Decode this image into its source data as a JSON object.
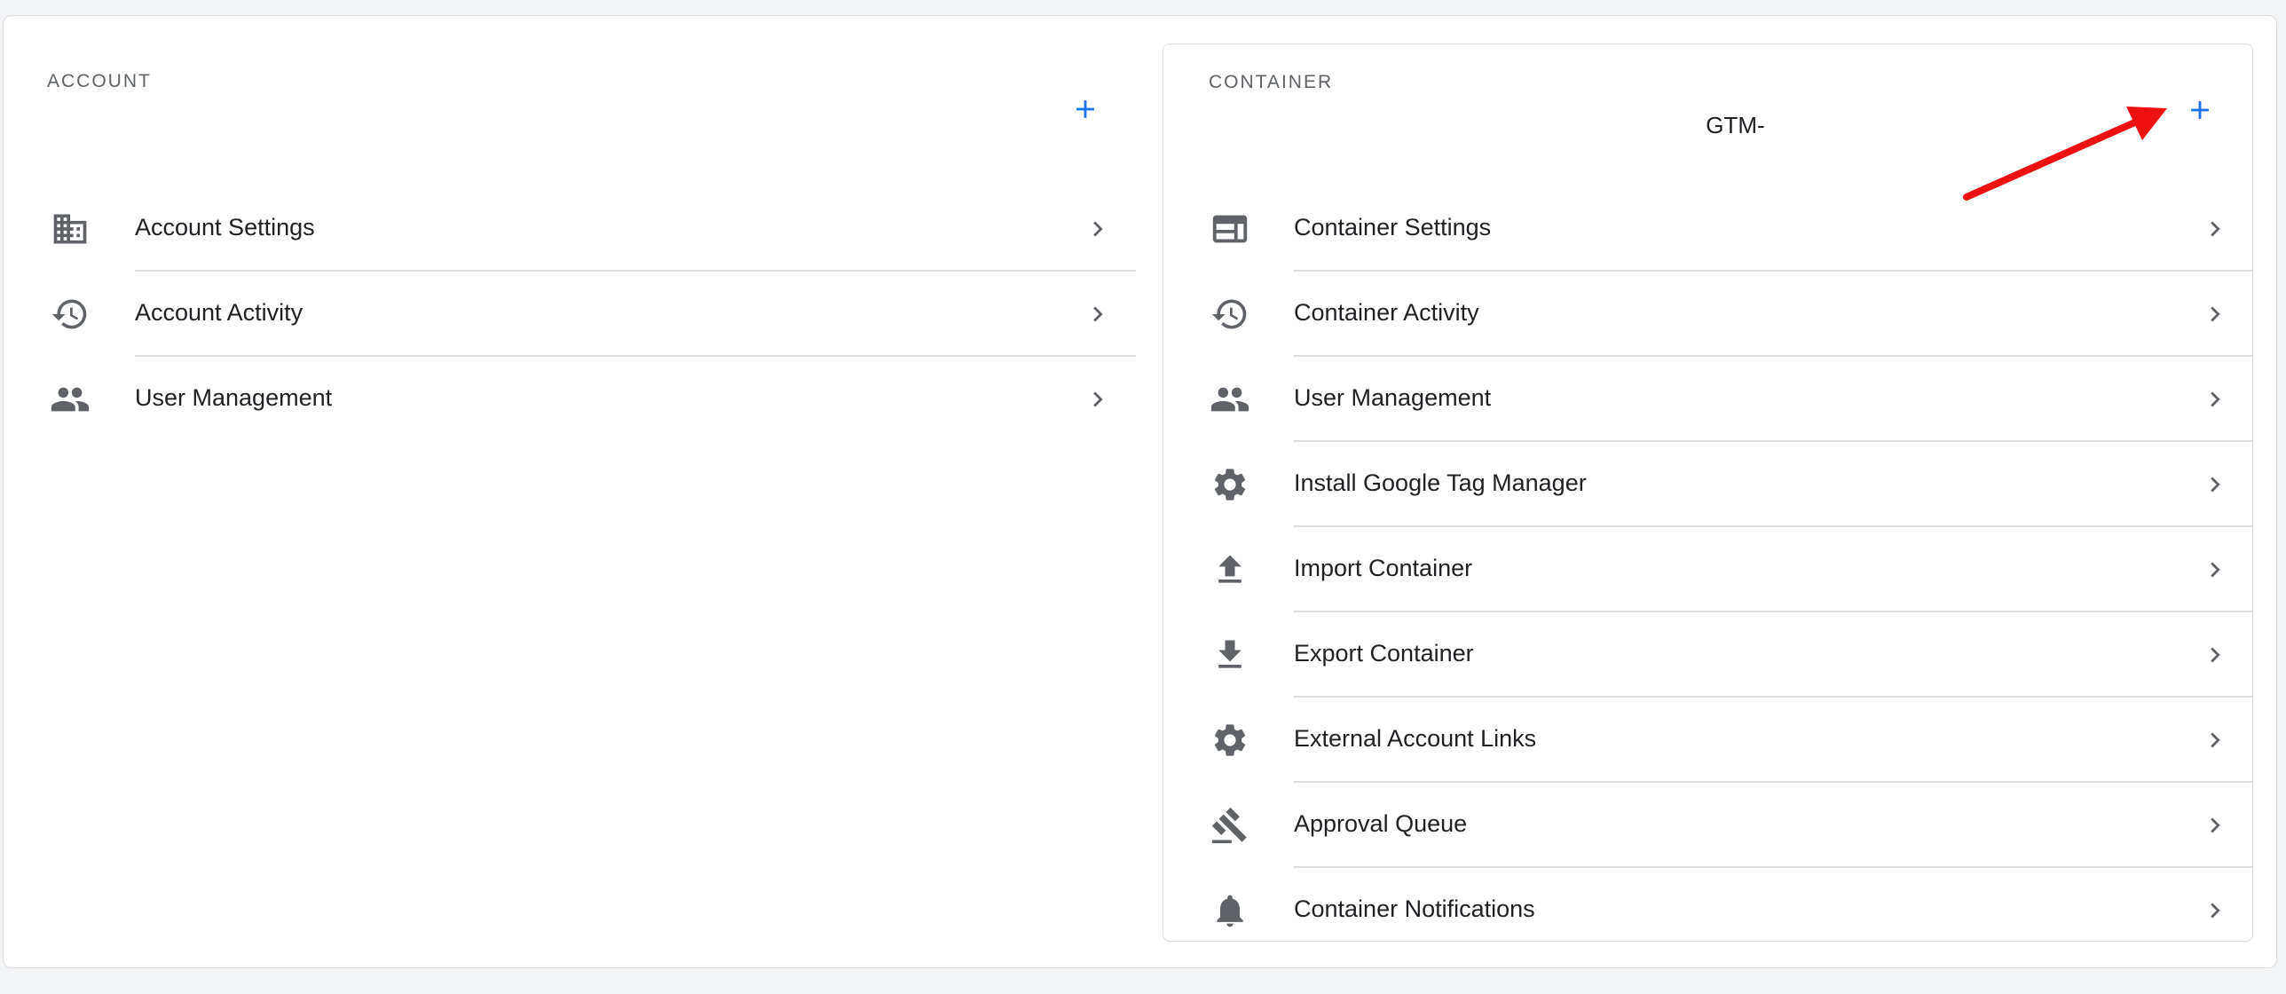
{
  "colors": {
    "accent": "#1a73e8",
    "icon": "#5f6368",
    "divider": "#dadce0",
    "annotation_arrow": "#ee1111"
  },
  "account": {
    "title": "ACCOUNT",
    "add_icon": "plus-icon",
    "items": [
      {
        "label": "Account Settings",
        "icon": "domain-icon"
      },
      {
        "label": "Account Activity",
        "icon": "history-icon"
      },
      {
        "label": "User Management",
        "icon": "people-icon"
      }
    ]
  },
  "container": {
    "title": "CONTAINER",
    "container_id": "GTM-",
    "add_icon": "plus-icon",
    "items": [
      {
        "label": "Container Settings",
        "icon": "web-layout-icon"
      },
      {
        "label": "Container Activity",
        "icon": "history-icon"
      },
      {
        "label": "User Management",
        "icon": "people-icon"
      },
      {
        "label": "Install Google Tag Manager",
        "icon": "gear-icon"
      },
      {
        "label": "Import Container",
        "icon": "upload-icon"
      },
      {
        "label": "Export Container",
        "icon": "download-icon"
      },
      {
        "label": "External Account Links",
        "icon": "gear-icon"
      },
      {
        "label": "Approval Queue",
        "icon": "gavel-icon"
      },
      {
        "label": "Container Notifications",
        "icon": "bell-icon"
      }
    ]
  }
}
